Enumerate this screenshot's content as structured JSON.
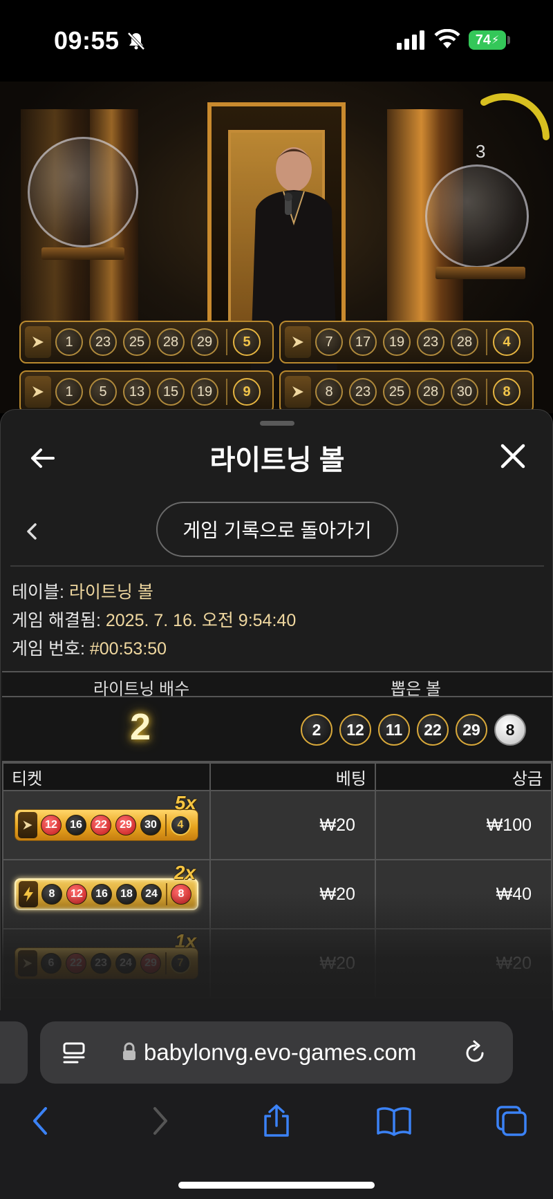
{
  "status_bar": {
    "time": "09:55",
    "battery": "74"
  },
  "video": {
    "timer_value": "3",
    "result_strips": [
      {
        "numbers": [
          "1",
          "23",
          "25",
          "28",
          "29"
        ],
        "bonus": "5"
      },
      {
        "numbers": [
          "7",
          "17",
          "19",
          "23",
          "28"
        ],
        "bonus": "4"
      },
      {
        "numbers": [
          "1",
          "5",
          "13",
          "15",
          "19"
        ],
        "bonus": "9"
      },
      {
        "numbers": [
          "8",
          "23",
          "25",
          "28",
          "30"
        ],
        "bonus": "8"
      }
    ]
  },
  "panel": {
    "title": "라이트닝 볼",
    "history_button": "게임 기록으로 돌아가기",
    "info": {
      "table_label": "테이블:",
      "table_value": "라이트닝 볼",
      "resolved_label": "게임 해결됨:",
      "resolved_value": "2025. 7. 16. 오전 9:54:40",
      "game_no_label": "게임 번호:",
      "game_no_value": "#00:53:50"
    },
    "summary": {
      "multiplier_header": "라이트닝 배수",
      "drawn_header": "뽑은 볼",
      "multiplier_value": "2",
      "drawn_balls": [
        "2",
        "12",
        "11",
        "22",
        "29",
        "8"
      ]
    },
    "bets_table": {
      "headers": {
        "ticket": "티켓",
        "bet": "베팅",
        "prize": "상금"
      },
      "rows": [
        {
          "type": "normal",
          "multiplier": "5x",
          "balls": [
            "12",
            "16",
            "22",
            "29",
            "30"
          ],
          "bonus": "4",
          "bet": "₩20",
          "prize": "₩100"
        },
        {
          "type": "lightning",
          "multiplier": "2x",
          "balls": [
            "8",
            "12",
            "16",
            "18",
            "24"
          ],
          "bonus": "8",
          "bet": "₩20",
          "prize": "₩40"
        },
        {
          "type": "normal",
          "multiplier": "1x",
          "balls": [
            "6",
            "22",
            "23",
            "24",
            "29"
          ],
          "bonus": "7",
          "bet": "₩20",
          "prize": "₩20"
        }
      ]
    }
  },
  "browser": {
    "url": "babylonvg.evo-games.com"
  },
  "colors": {
    "gold": "#f2c54a",
    "panel_bg": "#1d1d1d",
    "battery_green": "#34c759",
    "ios_blue": "#3b82f6"
  }
}
